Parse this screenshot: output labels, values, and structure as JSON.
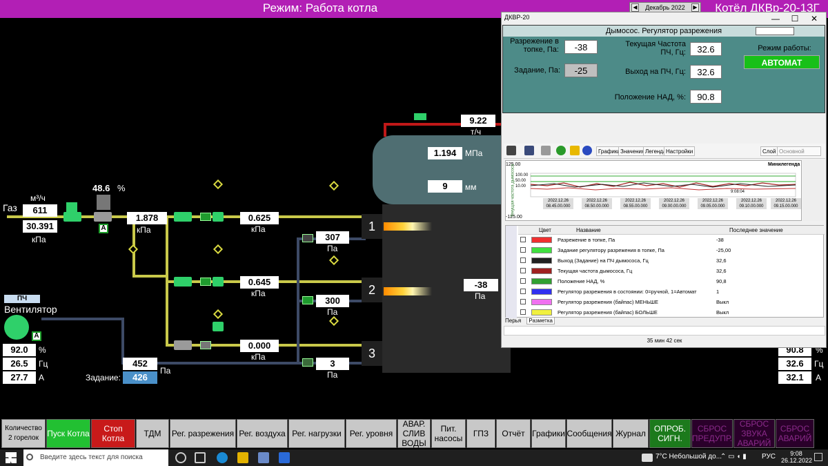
{
  "header": {
    "title": "Режим: Работа котла",
    "boiler": "Котёл ДКВр-20-13Г",
    "date": "Декабрь 2022"
  },
  "gas": {
    "label": "Газ",
    "flow_unit": "м³/ч",
    "flow": "611",
    "pressure": "30.391",
    "pressure_unit": "кПа",
    "valve_pos": "48.6",
    "valve_pos_unit": "%",
    "mode": "A",
    "after_regulator": "1.878",
    "after_regulator_unit": "кПа"
  },
  "burners": [
    {
      "num": "1",
      "gas": "0.625",
      "air": "307"
    },
    {
      "num": "2",
      "gas": "0.645",
      "air": "300"
    },
    {
      "num": "3",
      "gas": "0.000",
      "air": "3"
    }
  ],
  "units": {
    "kpa": "кПа",
    "pa": "Па",
    "mpa": "МПа",
    "mm": "мм",
    "th": "т/ч"
  },
  "steam": {
    "flow": "9.22",
    "pressure": "1.194",
    "level": "9"
  },
  "furnace": {
    "vacuum": "-38"
  },
  "fan": {
    "mode_label": "ПЧ",
    "label": "Вентилятор",
    "mode": "A",
    "load": "92.0",
    "freq": "26.5",
    "current": "27.7",
    "load_unit": "%",
    "freq_unit": "Гц",
    "current_unit": "А",
    "pressure": "452",
    "setpoint_label": "Задание:",
    "setpoint": "426"
  },
  "smoke_right": {
    "load": "90.8",
    "freq": "32.6",
    "current": "32.1",
    "load_unit": "%",
    "freq_unit": "Гц",
    "current_unit": "А"
  },
  "window": {
    "title": "ДКВР-20",
    "panel_title": "Дымосос. Регулятор разрежения",
    "panel_mode": "ПЧ",
    "vacuum_label": "Разрежение в топке, Па:",
    "vacuum": "-38",
    "setpoint_label": "Задание, Па:",
    "setpoint": "-25",
    "freq_label": "Текущая Частота ПЧ, Гц:",
    "freq": "32.6",
    "output_label": "Выход на ПЧ, Гц:",
    "output": "32.6",
    "nad_label": "Положение НАД, %:",
    "nad": "90.8",
    "mode_label": "Режим работы:",
    "mode": "АВТОМАТ",
    "tabs": [
      "Графики",
      "Значения",
      "Легенда",
      "Настройки"
    ],
    "layer_label": "Слой",
    "layer_value": "Основной",
    "minilegend": "Минилегенда",
    "chart_ytop": "125.00",
    "chart_ybottom": "-125.00",
    "chart_yaxis": "Текущая частота дымососа",
    "chart_marks": [
      "100.00",
      "50.00",
      "10.00"
    ],
    "chart_time": "9:08:04",
    "time_labels": [
      "2022.12.26 08.45.00.000",
      "2022.12.26 08.50.00.000",
      "2022.12.26 08.55.00.000",
      "2022.12.26 09.00.00.000",
      "2022.12.26 09.05.00.000",
      "2022.12.26 09.10.00.000",
      "2022.12.26 09.15.00.000"
    ],
    "legend_headers": {
      "color": "Цвет",
      "name": "Название",
      "last": "Последнее значение"
    },
    "legend": [
      {
        "color": "#f03030",
        "name": "Разрежение в топке, Па",
        "value": "-38"
      },
      {
        "color": "#40e040",
        "name": "Задание регулятору разрежения в топке, Па",
        "value": "-25,00"
      },
      {
        "color": "#202020",
        "name": "Выход (Задание) на ПЧ дымососа, Гц",
        "value": "32,6"
      },
      {
        "color": "#a02020",
        "name": "Текущая частота дымососа, Гц",
        "value": "32,6"
      },
      {
        "color": "#30a030",
        "name": "Положение НАД, %",
        "value": "90,8"
      },
      {
        "color": "#3030f0",
        "name": "Регулятор разрежения в состоянии: 0=ручной, 1=Автомат",
        "value": "1"
      },
      {
        "color": "#f070f0",
        "name": "Регулятор разрежения (байпас) МЕНЬШЕ",
        "value": "Выкл"
      },
      {
        "color": "#f0f040",
        "name": "Регулятор разрежения (байпас) БОЛЬШЕ",
        "value": "Выкл"
      }
    ],
    "bottom_tabs": [
      "Перья",
      "Разметка"
    ],
    "status": "35 мин 42 сек"
  },
  "bottom_buttons": [
    {
      "label": "Количество 2 горелок"
    },
    {
      "label": "Пуск Котла"
    },
    {
      "label": "Стоп Котла"
    },
    {
      "label": "ТДМ"
    },
    {
      "label": "Рег. разрежения"
    },
    {
      "label": "Рег. воздуха"
    },
    {
      "label": "Рег. нагрузки"
    },
    {
      "label": "Рег. уровня"
    },
    {
      "label": "АВАР. СЛИВ ВОДЫ"
    },
    {
      "label": "Пит. насосы"
    },
    {
      "label": "ГПЗ"
    },
    {
      "label": "Отчёт"
    },
    {
      "label": "Графики"
    },
    {
      "label": "Сообщения"
    },
    {
      "label": "Журнал"
    },
    {
      "label": "ОПРОБ. СИГН."
    },
    {
      "label": "СБРОС ПРЕДУПР."
    },
    {
      "label": "СБРОС ЗВУКА АВАРИЙ"
    },
    {
      "label": "СБРОС АВАРИЙ"
    }
  ],
  "taskbar": {
    "search_placeholder": "Введите здесь текст для поиска",
    "weather": "7°C Небольшой до...",
    "lang": "РУС",
    "time": "9:08",
    "date": "26.12.2022"
  },
  "colors": {
    "accent": "#b21fb5",
    "pipe_gas": "#c9c94a",
    "pipe_air": "#3d4a66",
    "pipe_steam": "#c01818",
    "valve_open": "#2fd06a",
    "auto": "#18c018",
    "setpoint": "#4a90c8"
  }
}
